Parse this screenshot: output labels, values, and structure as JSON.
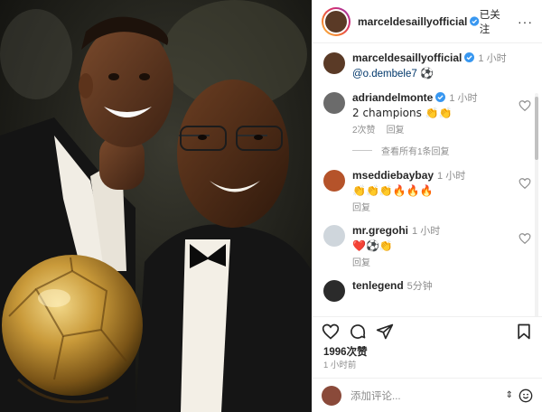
{
  "header": {
    "username": "marceldesaillyofficial",
    "follow_label": "已关注",
    "more_label": "···"
  },
  "caption": {
    "username": "marceldesaillyofficial",
    "time": "1 小时",
    "mention": "@o.dembele7",
    "emoji": "⚽"
  },
  "comments": [
    {
      "username": "adriandelmonte",
      "time": "1 小时",
      "text": "2 champions 👏👏",
      "likes": "2次赞",
      "reply": "回复",
      "verified": true
    },
    {
      "username": "mseddiebaybay",
      "time": "1 小时",
      "text": "👏👏👏🔥🔥🔥",
      "reply": "回复"
    },
    {
      "username": "mr.gregohi",
      "time": "1 小时",
      "text": "❤️⚽👏",
      "reply": "回复"
    },
    {
      "username": "tenlegend",
      "time": "5分钟",
      "text": "",
      "reply": ""
    }
  ],
  "view_replies": "查看所有1条回复",
  "likes_count": "1996次赞",
  "posted_ago": "1 小时前",
  "comment_input": {
    "placeholder": "添加评论..."
  },
  "colors": {
    "verified": "#3897f0",
    "text": "#262626",
    "muted": "#8e8e8e",
    "link": "#00376b"
  },
  "icons": [
    "heart-icon",
    "comment-icon",
    "share-icon",
    "bookmark-icon",
    "emoji-icon",
    "more-icon",
    "verified-icon"
  ]
}
